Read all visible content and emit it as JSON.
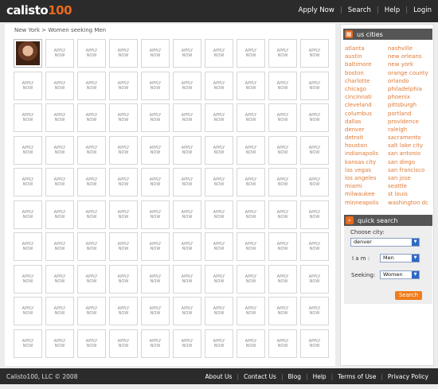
{
  "header": {
    "logo_main": "calisto",
    "logo_num": "100",
    "nav": [
      "Apply Now",
      "Search",
      "Help",
      "Login"
    ]
  },
  "breadcrumb": "New York > Women seeking Men",
  "grid": {
    "apply_line1": "APPLY",
    "apply_line2": "NOW",
    "rows": 10,
    "cols": 10
  },
  "sidebar": {
    "title": "us cities",
    "cities": [
      "atlanta",
      "nashville",
      "austin",
      "new orleans",
      "baltimore",
      "new york",
      "boston",
      "orange county",
      "charlotte",
      "orlando",
      "chicago",
      "philadelphia",
      "cincinnati",
      "phoenix",
      "cleveland",
      "pittsburgh",
      "columbus",
      "portland",
      "dallas",
      "providence",
      "denver",
      "raleigh",
      "detroit",
      "sacramento",
      "houston",
      "salt lake city",
      "indianapolis",
      "san antonio",
      "kansas city",
      "san diego",
      "las vegas",
      "san francisco",
      "los angeles",
      "san jose",
      "miami",
      "seattle",
      "milwaukee",
      "st louis",
      "minneapolis",
      "washington dc"
    ]
  },
  "quick_search": {
    "title": "quick search",
    "city_label": "Choose city:",
    "city_value": "denver",
    "iam_label": "I a m :",
    "iam_value": "Men",
    "seeking_label": "Seeking:",
    "seeking_value": "Women",
    "button": "Search"
  },
  "footer": {
    "copyright": "Calisto100, LLC © 2008",
    "links": [
      "About Us",
      "Contact Us",
      "Blog",
      "Help",
      "Terms of Use",
      "Privacy Policy"
    ]
  },
  "colors": {
    "accent": "#e8691f",
    "header_bg": "#2b2b2b",
    "city_link": "#e07a36"
  }
}
